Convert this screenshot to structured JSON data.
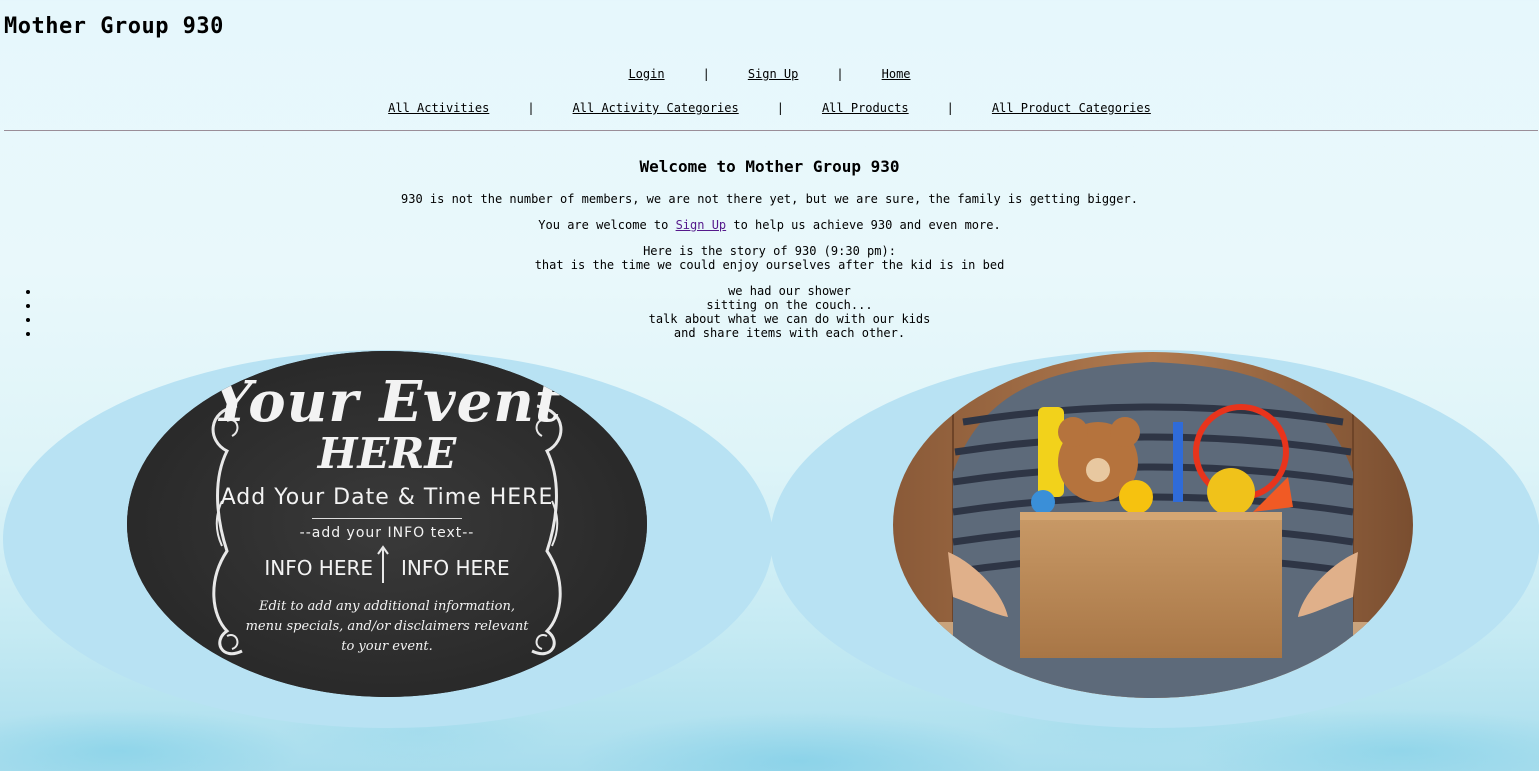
{
  "site": {
    "title": "Mother Group 930"
  },
  "nav": {
    "row1": [
      {
        "label": "Login"
      },
      {
        "label": "Sign Up"
      },
      {
        "label": "Home"
      }
    ],
    "row2": [
      {
        "label": "All Activities"
      },
      {
        "label": "All Activity Categories"
      },
      {
        "label": "All Products"
      },
      {
        "label": "All Product Categories"
      }
    ],
    "separator": "|"
  },
  "main": {
    "heading": "Welcome to Mother Group 930",
    "intro": "930 is not the number of members, we are not there yet, but we are sure, the family is getting bigger.",
    "invite_before": "You are welcome to ",
    "invite_link": "Sign Up",
    "invite_after": " to help us achieve 930 and even more.",
    "story_line1": "Here is the story of 930 (9:30 pm):",
    "story_line2": "that is the time we could enjoy ourselves after the kid is in bed",
    "story_items": [
      "we had our shower",
      "sitting on the couch...",
      "talk about what we can do with our kids",
      "and share items with each other."
    ]
  },
  "event_image": {
    "line1": "Your Event",
    "line2": "HERE",
    "line3": "Add Your Date & Time HERE",
    "line4": "--add your INFO text--",
    "info_a": "INFO HERE",
    "info_b": "INFO HERE",
    "footer": "Edit to add any additional information, menu specials, and/or disclaimers relevant to your event."
  },
  "colors": {
    "bubble": "#b8e2f3",
    "visited_link": "#551a8b",
    "chalkboard": "#2f2f2f"
  }
}
